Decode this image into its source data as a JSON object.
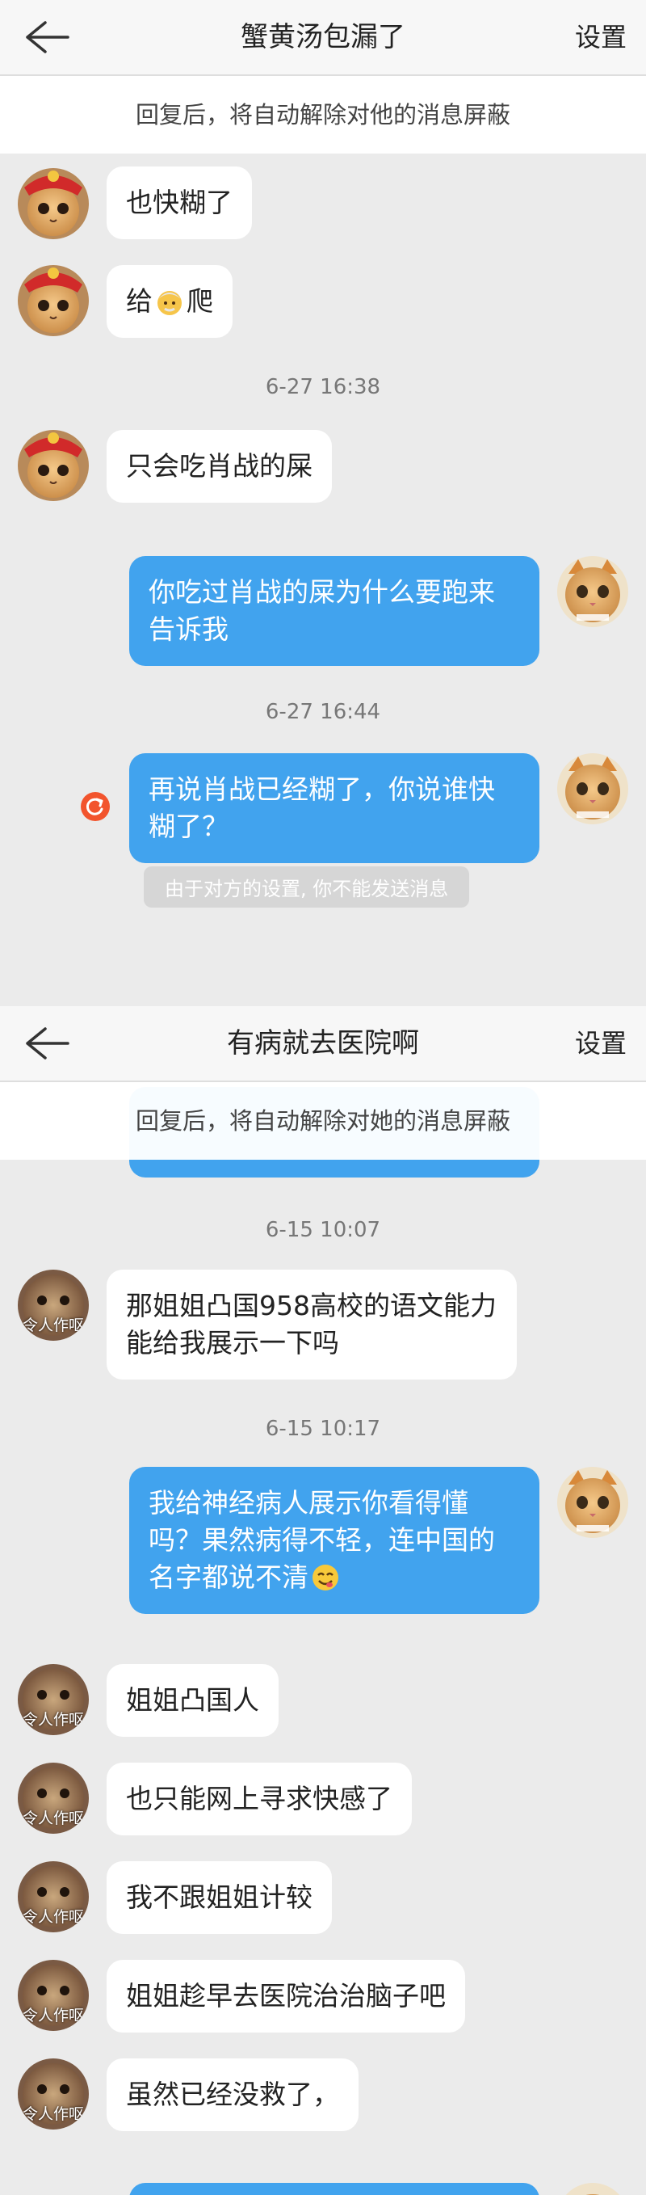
{
  "panel1": {
    "title": "蟹黄汤包漏了",
    "settings": "设置",
    "notice": "回复后，将自动解除对他的消息屏蔽",
    "msg1": "也快糊了",
    "msg2a": "给",
    "msg2b": "爬",
    "time1": "6-27 16:38",
    "msg3": "只会吃肖战的屎",
    "msg4": "你吃过肖战的屎为什么要跑来告诉我",
    "time2": "6-27 16:44",
    "msg5": "再说肖战已经糊了，你说谁快糊了？",
    "blocked": "由于对方的设置, 你不能发送消息"
  },
  "panel2": {
    "title": "有病就去医院啊",
    "settings": "设置",
    "notice": "回复后，将自动解除对她的消息屏蔽",
    "time1": "6-15 10:07",
    "msg1": "那姐姐凸国958高校的语文能力能给我展示一下吗",
    "time2": "6-15 10:17",
    "msg2": "我给神经病人展示你看得懂吗？果然病得不轻，连中国的名字都说不清",
    "msg3": "姐姐凸国人",
    "msg4": "也只能网上寻求快感了",
    "msg5": "我不跟姐姐计较",
    "msg6": "姐姐趁早去医院治治脑子吧",
    "msg7": "虽然已经没救了，"
  },
  "avatar_caption": "令人作呕",
  "colors": {
    "outgoing_bubble": "#41a3ee",
    "incoming_bubble": "#ffffff",
    "background": "#ebebeb",
    "error": "#f2542d"
  },
  "icons": [
    "back-arrow-icon",
    "retry-error-icon",
    "emoji-old-man",
    "emoji-yum-face",
    "cat-avatar",
    "festive-cat-avatar"
  ]
}
